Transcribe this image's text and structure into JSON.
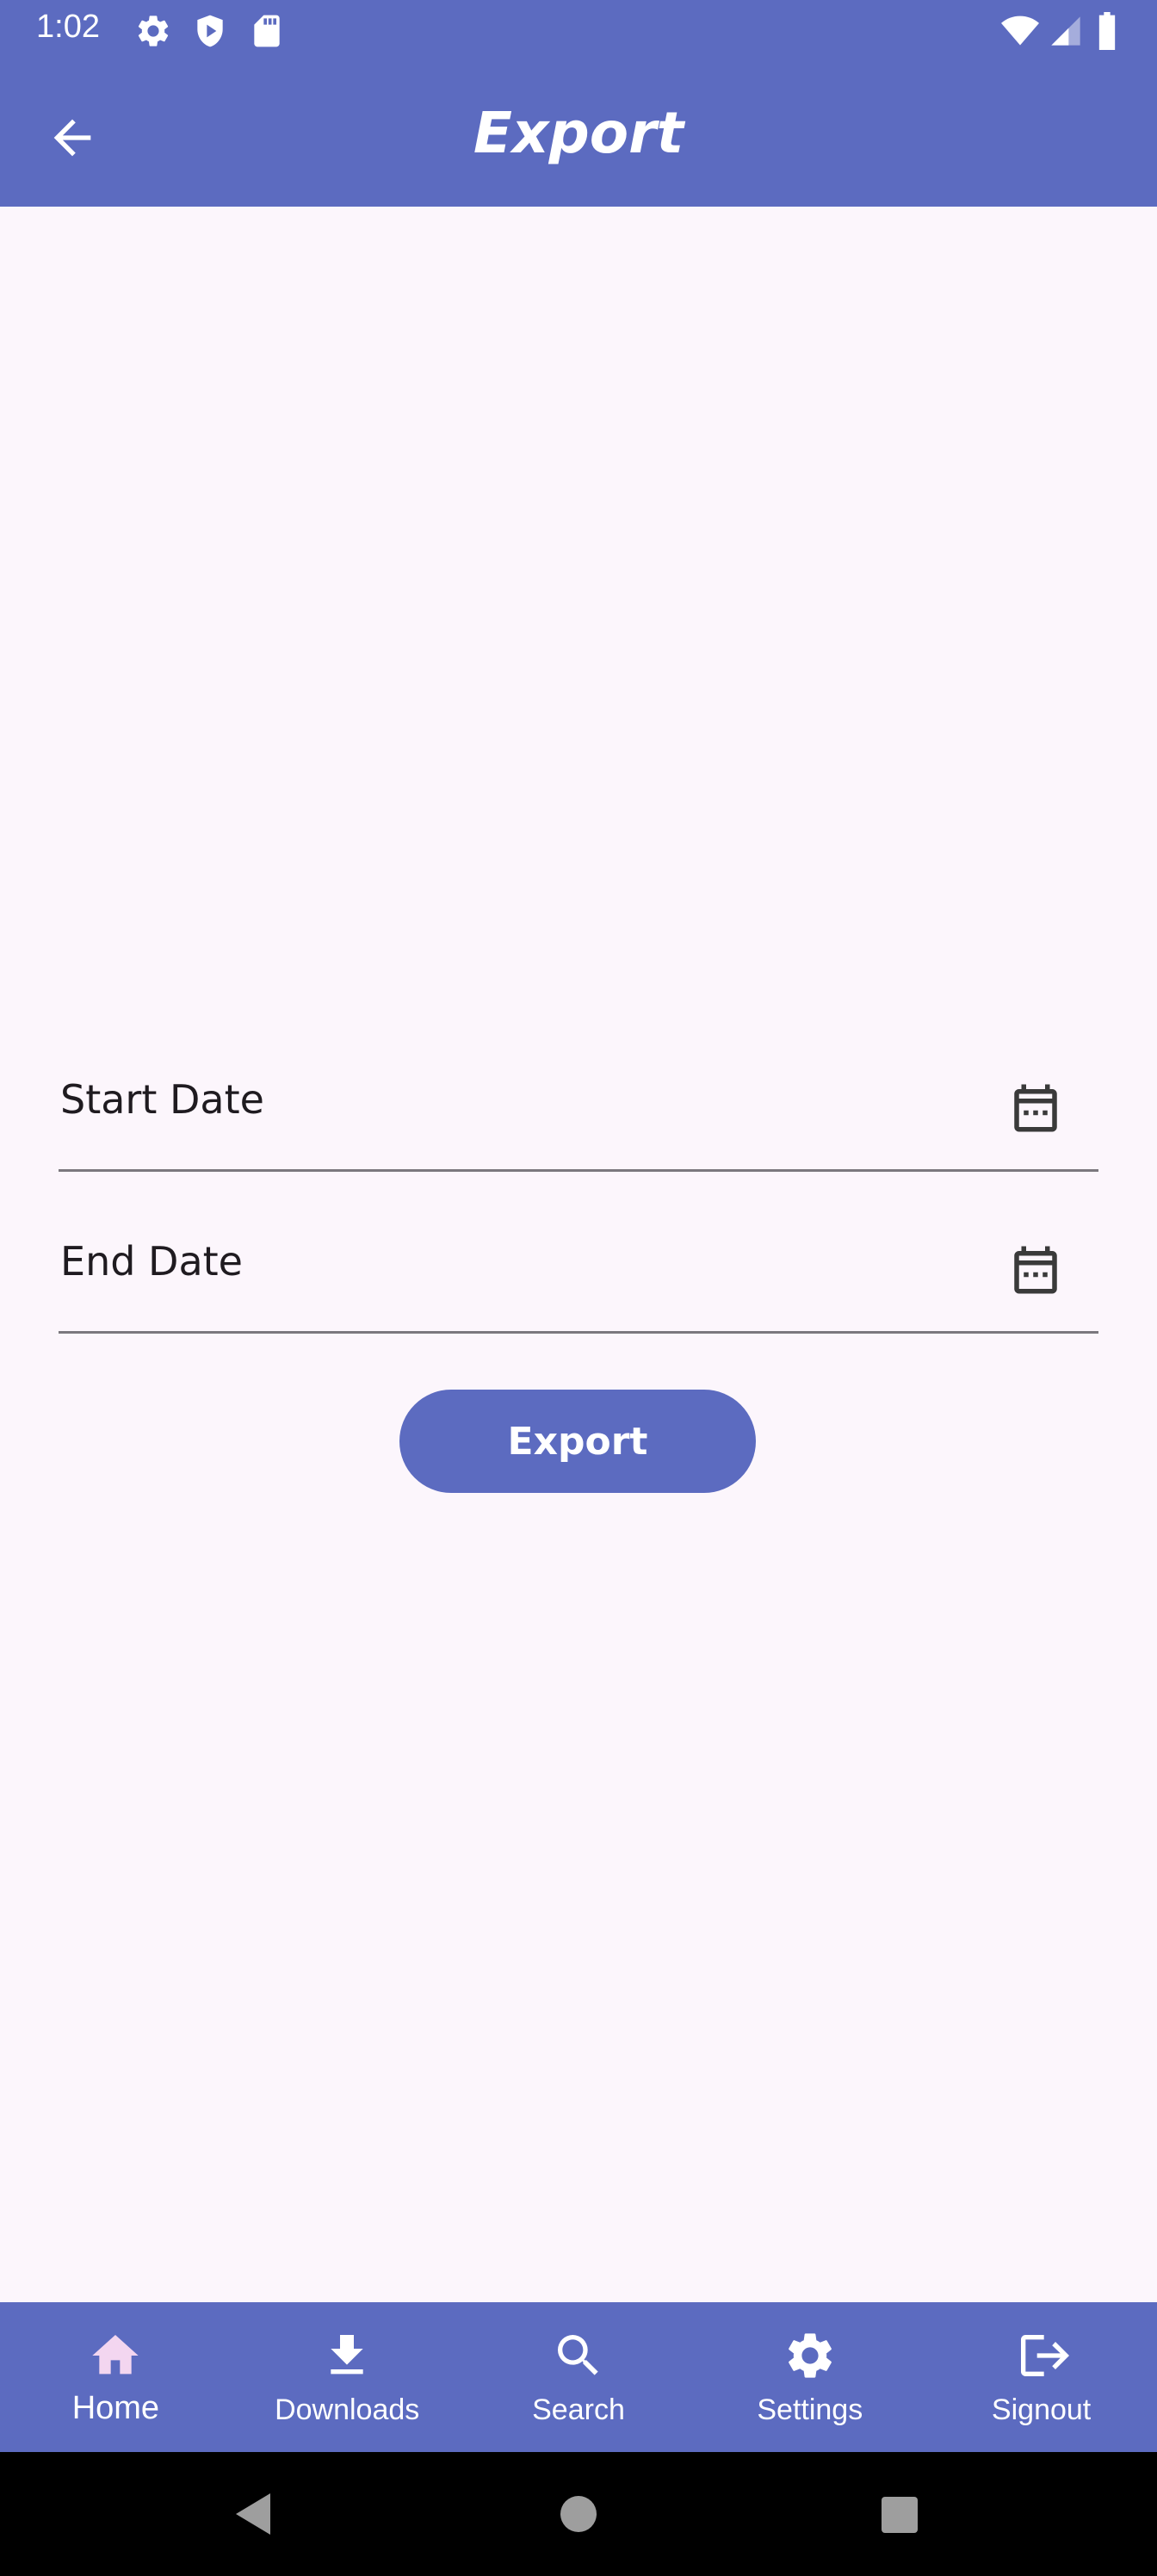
{
  "status_bar": {
    "time": "1:02",
    "icons": [
      "gear-icon",
      "shield-play-icon",
      "sd-card-icon",
      "wifi-icon",
      "signal-icon",
      "battery-icon"
    ]
  },
  "app_bar": {
    "title": "Export",
    "back_icon": "arrow-left-icon"
  },
  "form": {
    "start_date": {
      "label": "Start Date",
      "icon": "calendar-icon"
    },
    "end_date": {
      "label": "End Date",
      "icon": "calendar-icon"
    },
    "export_button": "Export"
  },
  "bottom_nav": {
    "items": [
      {
        "label": "Home",
        "icon": "home-icon",
        "active": true
      },
      {
        "label": "Downloads",
        "icon": "download-icon",
        "active": false
      },
      {
        "label": "Search",
        "icon": "search-icon",
        "active": false
      },
      {
        "label": "Settings",
        "icon": "gear-icon",
        "active": false
      },
      {
        "label": "Signout",
        "icon": "logout-icon",
        "active": false
      }
    ]
  },
  "system_nav": [
    "back-triangle-icon",
    "home-circle-icon",
    "recents-square-icon"
  ],
  "colors": {
    "primary": "#5c6bc0",
    "background": "#fcf6fc",
    "active_icon": "#f3d6f0",
    "text": "#1f1b20",
    "divider": "#7b787e"
  }
}
